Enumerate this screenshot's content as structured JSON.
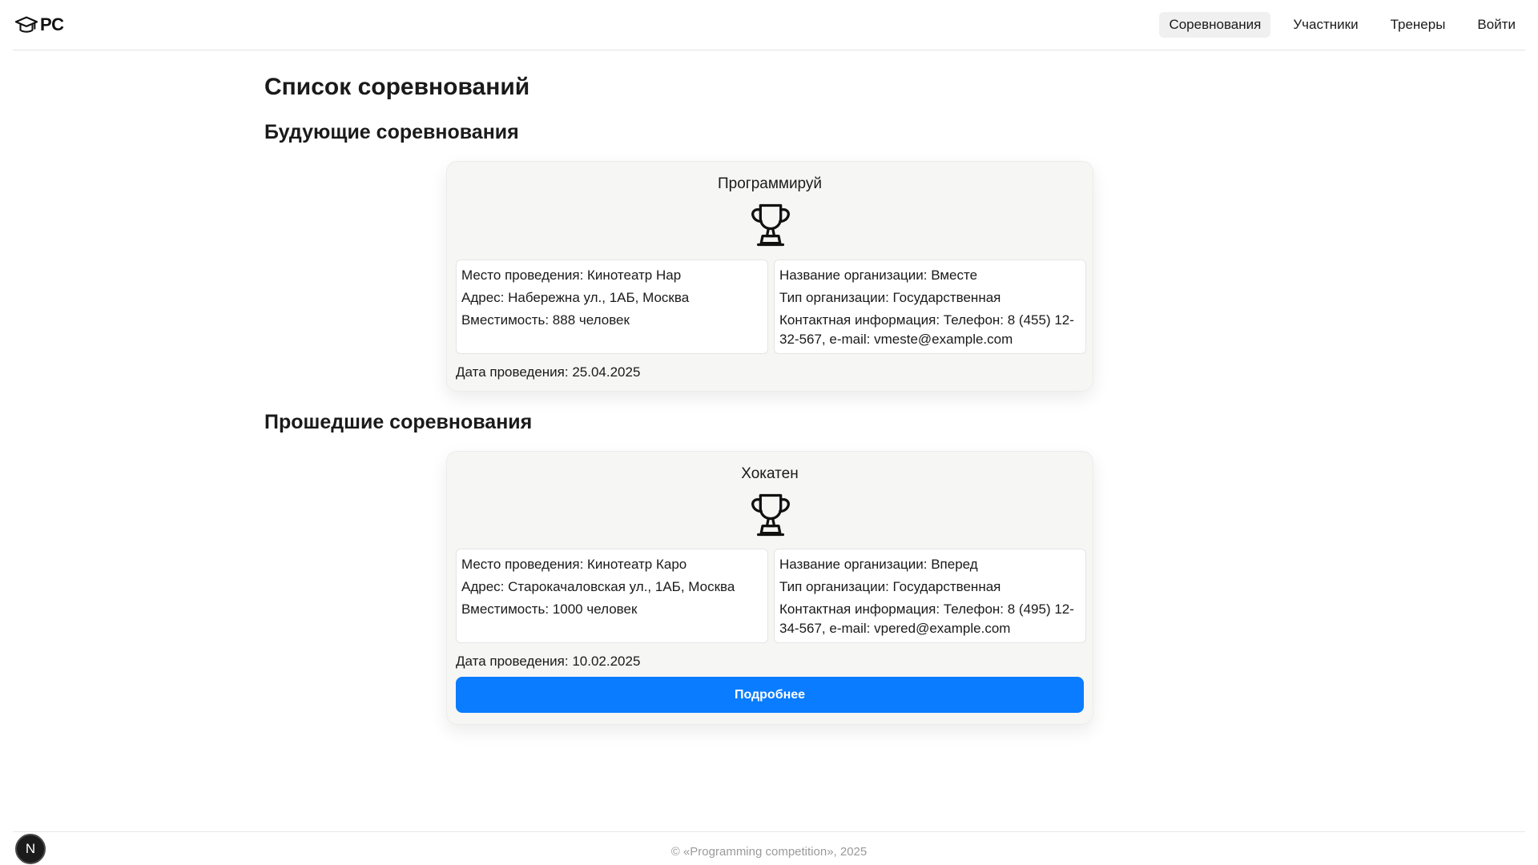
{
  "header": {
    "logo_text": "PC",
    "logo_icon": "graduation-cap-icon",
    "nav": [
      {
        "label": "Соревнования",
        "active": true
      },
      {
        "label": "Участники",
        "active": false
      },
      {
        "label": "Тренеры",
        "active": false
      },
      {
        "label": "Войти",
        "active": false
      }
    ]
  },
  "page": {
    "title": "Список соревнований",
    "upcoming_title": "Будующие соревнования",
    "past_title": "Прошедшие соревнования"
  },
  "upcoming": [
    {
      "name": "Программируй",
      "icon": "trophy-icon",
      "venue": "Место проведения: Кинотеатр Нар",
      "address": "Адрес: Набережна ул., 1АБ, Москва",
      "capacity": "Вместимость: 888 человек",
      "org_name": "Название организации: Вместе",
      "org_type": "Тип организации: Государственная",
      "contact": "Контактная информация: Телефон: 8 (455) 12-32-567, e-mail: vmeste@example.com",
      "date": "Дата проведения: 25.04.2025"
    }
  ],
  "past": [
    {
      "name": "Хокатен",
      "icon": "trophy-icon",
      "venue": "Место проведения: Кинотеатр Каро",
      "address": "Адрес: Старокачаловская ул., 1АБ, Москва",
      "capacity": "Вместимость: 1000 человек",
      "org_name": "Название организации: Вперед",
      "org_type": "Тип организации: Государственная",
      "contact": "Контактная информация: Телефон: 8 (495) 12-34-567, e-mail: vpered@example.com",
      "date": "Дата проведения: 10.02.2025",
      "details_label": "Подробнее"
    }
  ],
  "footer": {
    "text": "© «Programming competition», 2025"
  },
  "dev_badge": {
    "label": "N"
  },
  "colors": {
    "primary_button": "#0a7cff",
    "card_background": "#f6f6f5",
    "active_nav_background": "#f0f0f0"
  }
}
